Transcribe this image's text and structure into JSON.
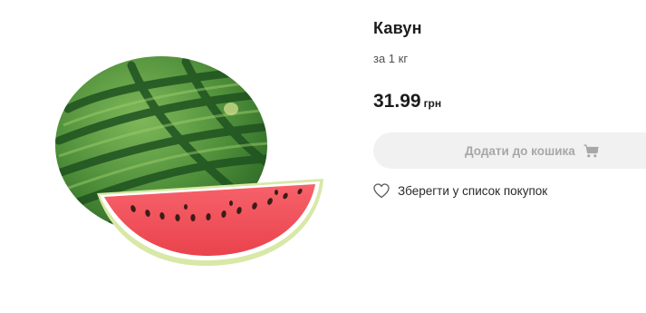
{
  "product": {
    "image_name": "watermelon-image",
    "title": "Кавун",
    "unit": "за 1 кг",
    "price": "31.99",
    "currency": "грн"
  },
  "actions": {
    "add_to_cart_label": "Додати до кошика",
    "add_to_cart_icon": "cart-icon",
    "save_to_list_label": "Зберегти у список покупок",
    "save_to_list_icon": "heart-icon"
  },
  "colors": {
    "button_background": "#f1f1f1",
    "button_text": "#a7a7a7",
    "text_primary": "#1c1c1c"
  }
}
